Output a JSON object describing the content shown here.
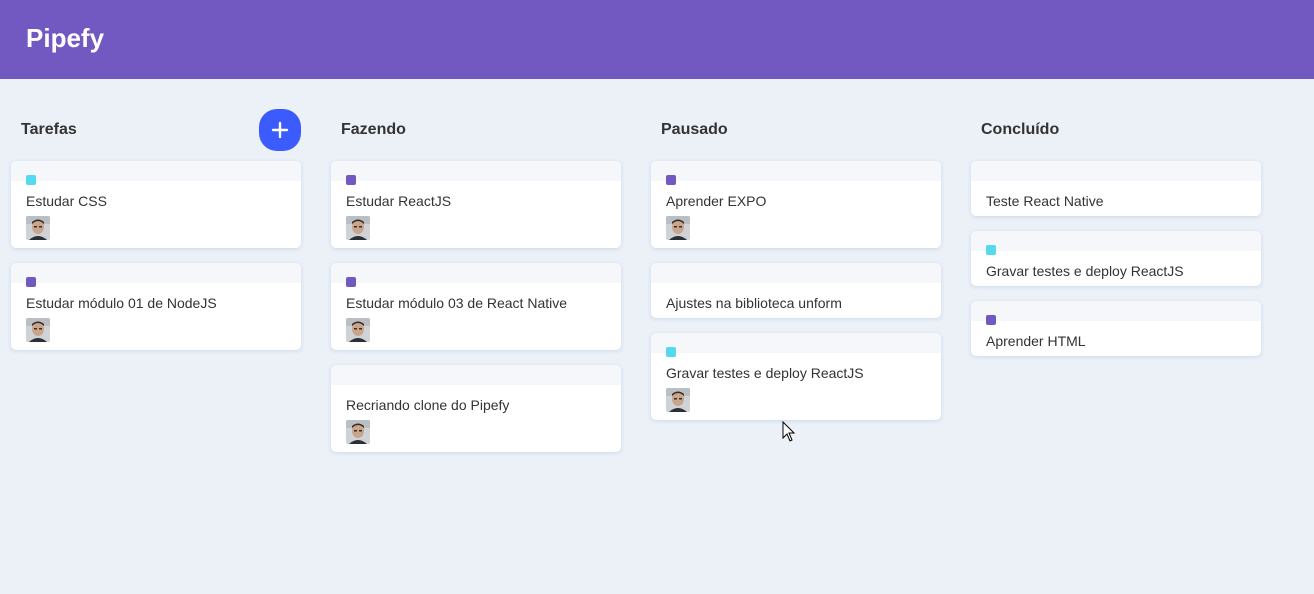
{
  "header": {
    "logo": "Pipefy"
  },
  "colors": {
    "header": "#7159c1",
    "background": "#ecf1f8",
    "add_button": "#3b5bfd",
    "tag_purple": "#7159c1",
    "tag_cyan": "#54d9ee"
  },
  "lists": [
    {
      "title": "Tarefas",
      "creatable": true,
      "cards": [
        {
          "content": "Estudar CSS",
          "label": "#54d9ee",
          "user": true
        },
        {
          "content": "Estudar módulo 01 de NodeJS",
          "label": "#7159c1",
          "user": true
        }
      ]
    },
    {
      "title": "Fazendo",
      "creatable": false,
      "cards": [
        {
          "content": "Estudar ReactJS",
          "label": "#7159c1",
          "user": true
        },
        {
          "content": "Estudar módulo 03 de React Native",
          "label": "#7159c1",
          "user": true
        },
        {
          "content": "Recriando clone do Pipefy",
          "label": null,
          "user": true
        }
      ]
    },
    {
      "title": "Pausado",
      "creatable": false,
      "cards": [
        {
          "content": "Aprender EXPO",
          "label": "#7159c1",
          "user": true
        },
        {
          "content": "Ajustes na biblioteca unform",
          "label": null,
          "user": false
        },
        {
          "content": "Gravar testes e deploy ReactJS",
          "label": "#54d9ee",
          "user": true
        }
      ]
    },
    {
      "title": "Concluído",
      "creatable": false,
      "cards": [
        {
          "content": "Teste React Native",
          "label": null,
          "user": false
        },
        {
          "content": "Gravar testes e deploy ReactJS",
          "label": "#54d9ee",
          "user": false
        },
        {
          "content": "Aprender HTML",
          "label": "#7159c1",
          "user": false
        }
      ]
    }
  ]
}
